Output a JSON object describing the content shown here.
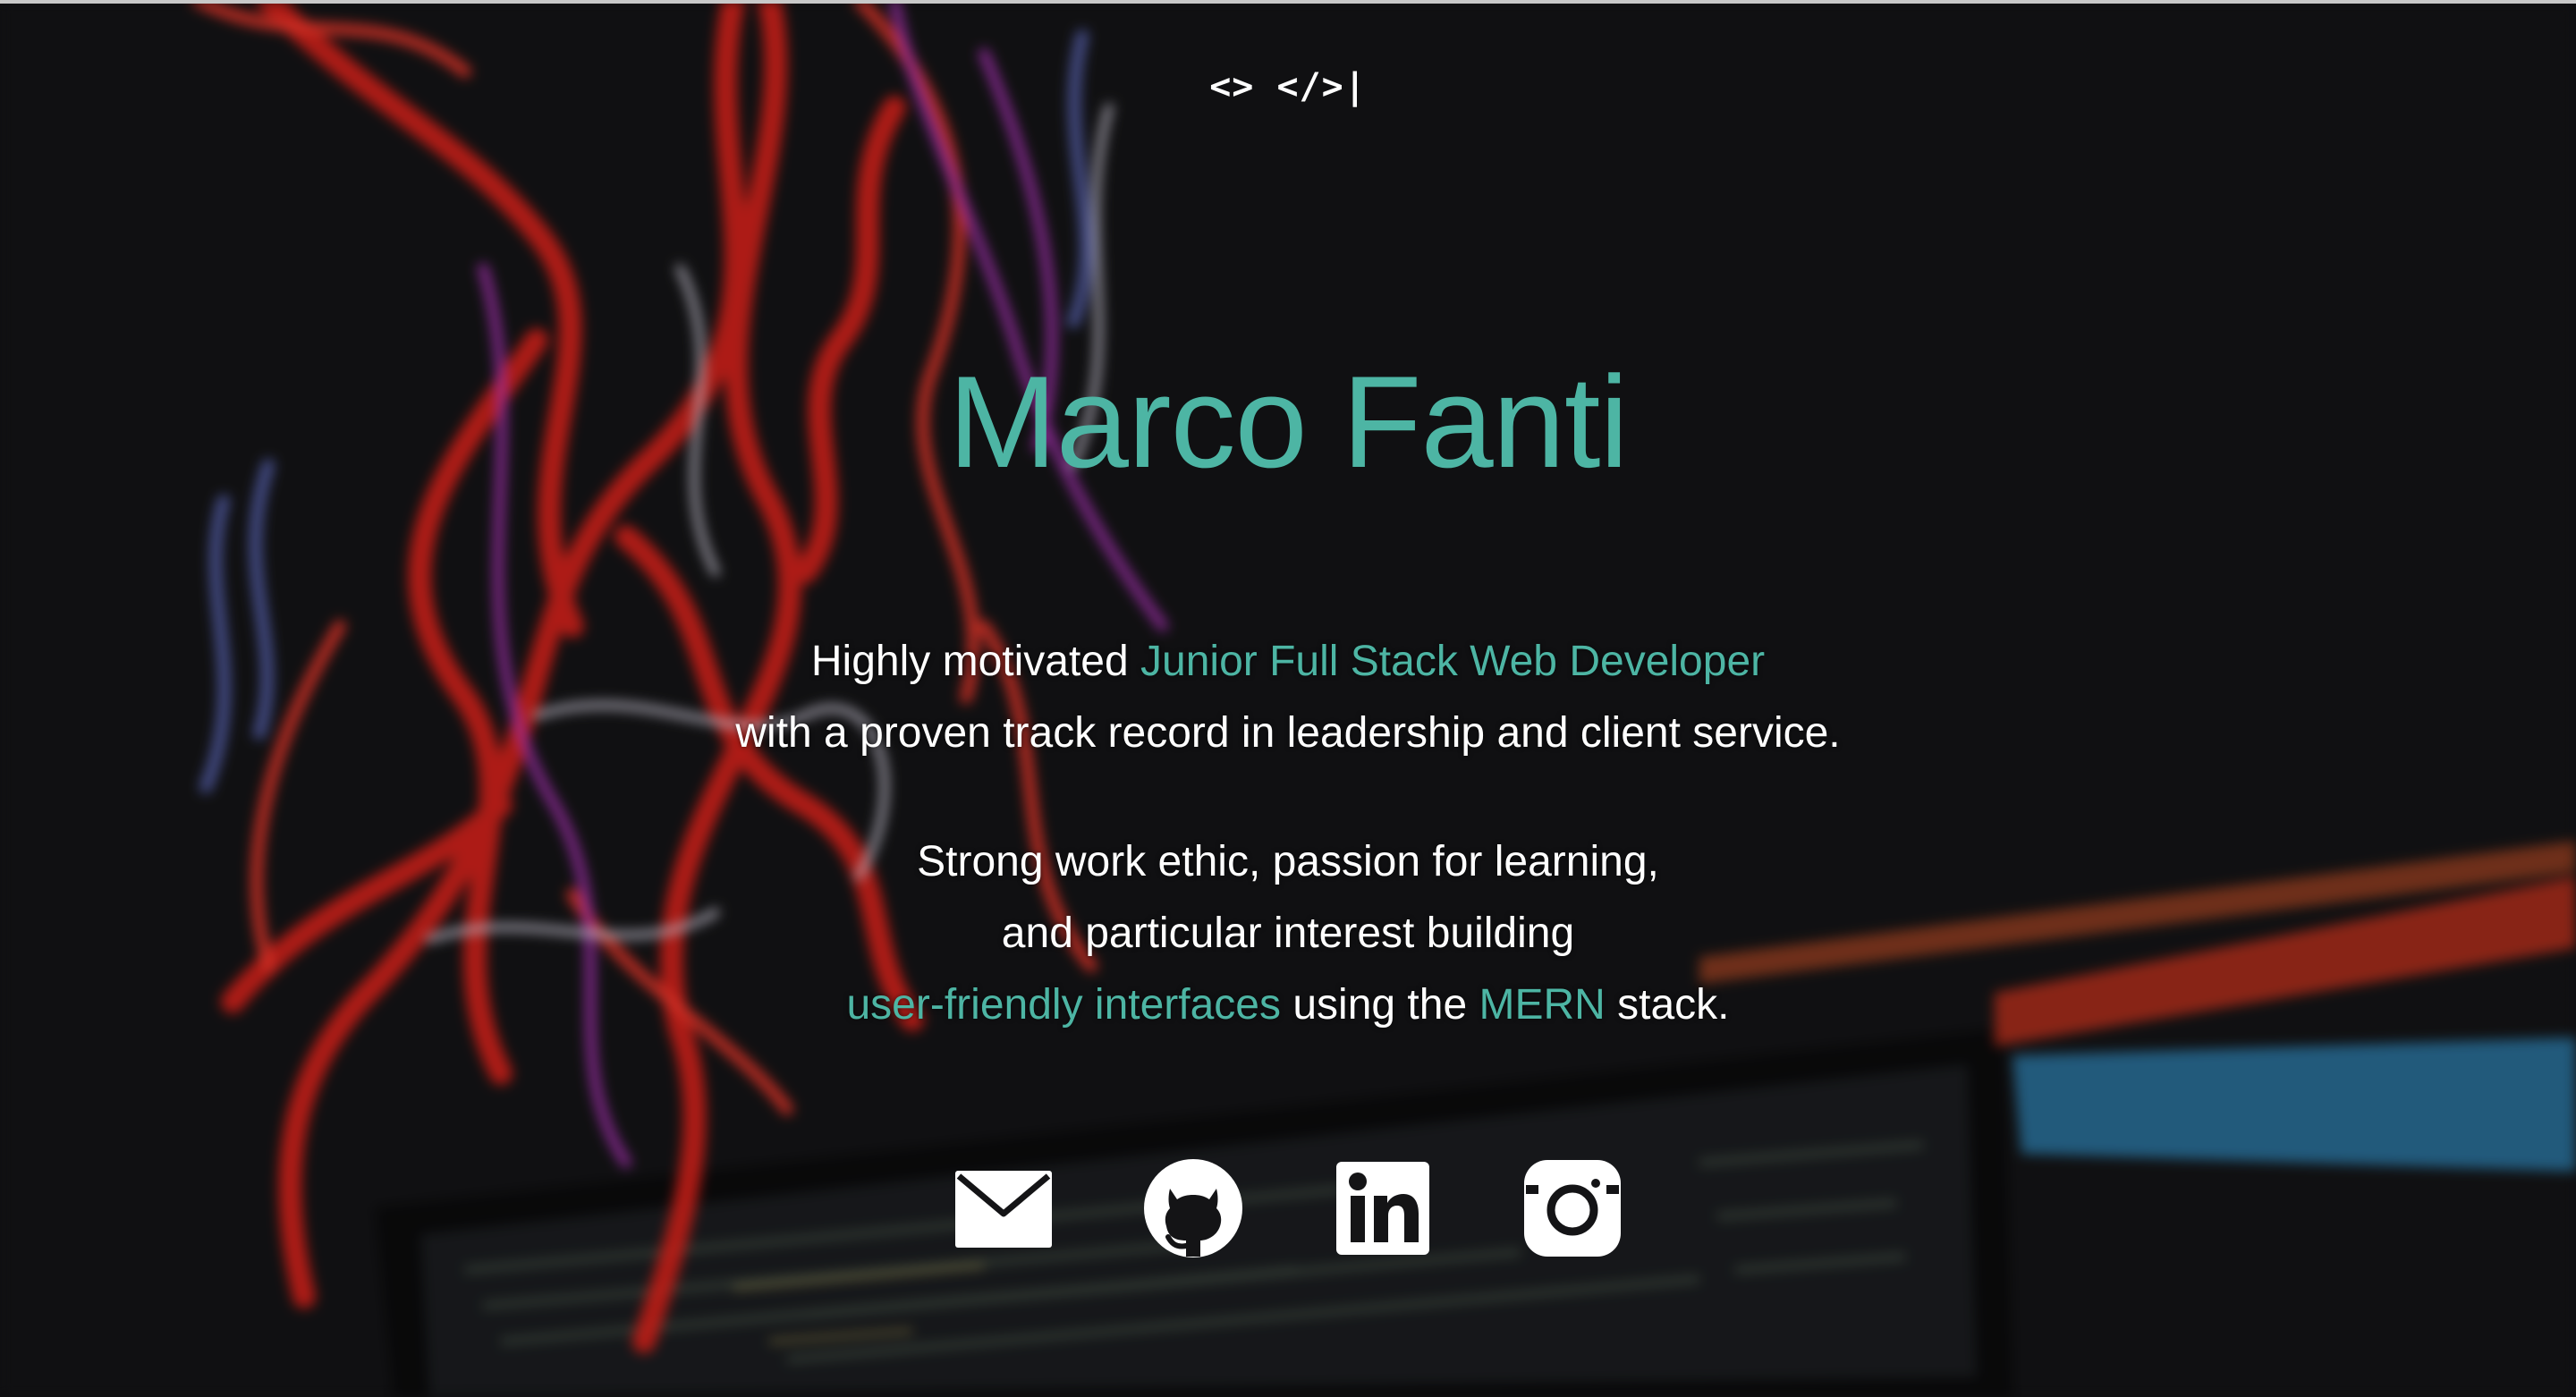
{
  "logo": {
    "text": "<> </>|"
  },
  "hero": {
    "name": "Marco Fanti",
    "line1_pre": "Highly motivated ",
    "line1_accent": "Junior Full Stack Web Developer",
    "line2": "with a proven track record in leadership and client service.",
    "line3": "Strong work ethic, passion for learning,",
    "line4": "and particular interest building",
    "line5_accent1": "user-friendly interfaces",
    "line5_mid": " using the ",
    "line5_accent2": "MERN",
    "line5_post": " stack."
  },
  "social": [
    {
      "icon": "mail-icon"
    },
    {
      "icon": "github-icon"
    },
    {
      "icon": "linkedin-icon"
    },
    {
      "icon": "instagram-icon"
    }
  ],
  "colors": {
    "accent": "#4db5a4",
    "background": "#131315",
    "text": "#ffffff"
  }
}
